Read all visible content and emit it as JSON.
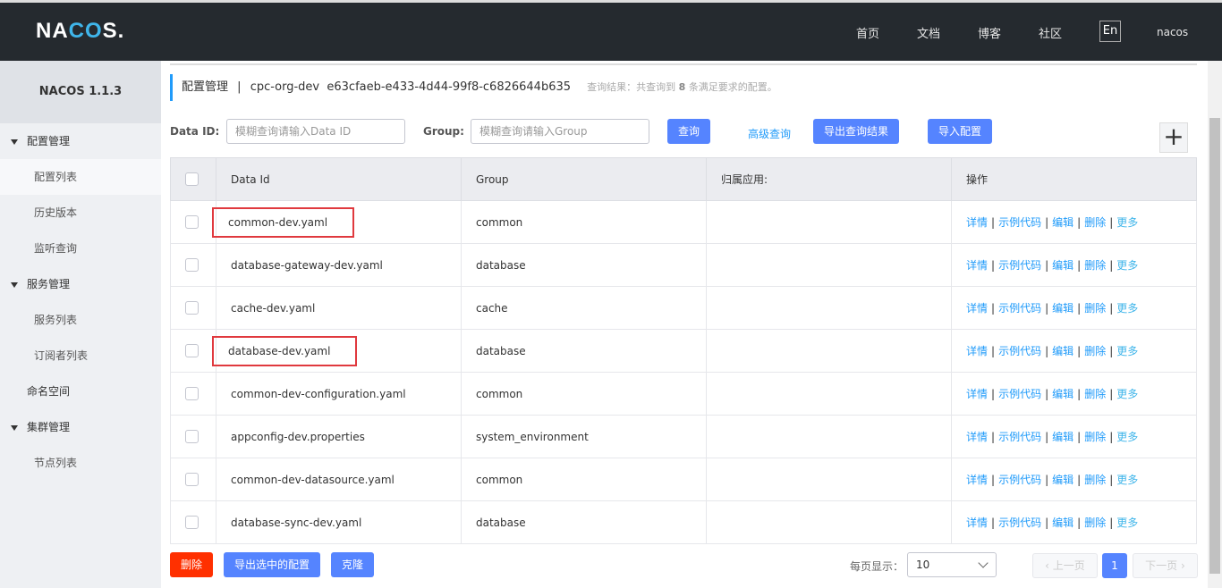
{
  "header": {
    "logo": "NACOS.",
    "logo_a": "NA",
    "logo_b": "CO",
    "logo_c": "S.",
    "nav": [
      "首页",
      "文档",
      "博客",
      "社区"
    ],
    "lang": "En",
    "user": "nacos"
  },
  "sidebar": {
    "title": "NACOS 1.1.3",
    "items": [
      {
        "label": "配置管理",
        "level": 1
      },
      {
        "label": "配置列表",
        "level": 2
      },
      {
        "label": "历史版本",
        "level": 2
      },
      {
        "label": "监听查询",
        "level": 2
      },
      {
        "label": "服务管理",
        "level": 1
      },
      {
        "label": "服务列表",
        "level": 2
      },
      {
        "label": "订阅者列表",
        "level": 2
      },
      {
        "label": "命名空间",
        "level": 0
      },
      {
        "label": "集群管理",
        "level": 1
      },
      {
        "label": "节点列表",
        "level": 2
      }
    ]
  },
  "page": {
    "title": "配置管理",
    "sep": "|",
    "namespace": "cpc-org-dev",
    "namespace_id": "e63cfaeb-e433-4d44-99f8-c6826644b635",
    "hint_pre": "查询结果：共查询到",
    "hint_count": "8",
    "hint_post": "条满足要求的配置。"
  },
  "filters": {
    "dataid_label": "Data ID:",
    "dataid_placeholder": "模糊查询请输入Data ID",
    "group_label": "Group:",
    "group_placeholder": "模糊查询请输入Group",
    "search": "查询",
    "advanced": "高级查询",
    "export_results": "导出查询结果",
    "import": "导入配置",
    "add": "+"
  },
  "table": {
    "headers": [
      "Data Id",
      "Group",
      "归属应用:",
      "操作"
    ],
    "rows": [
      {
        "data_id": "common-dev.yaml",
        "group": "common",
        "app": "",
        "highlighted": true
      },
      {
        "data_id": "database-gateway-dev.yaml",
        "group": "database",
        "app": ""
      },
      {
        "data_id": "cache-dev.yaml",
        "group": "cache",
        "app": ""
      },
      {
        "data_id": "database-dev.yaml",
        "group": "database",
        "app": "",
        "highlighted": true
      },
      {
        "data_id": "common-dev-configuration.yaml",
        "group": "common",
        "app": ""
      },
      {
        "data_id": "appconfig-dev.properties",
        "group": "system_environment",
        "app": ""
      },
      {
        "data_id": "common-dev-datasource.yaml",
        "group": "common",
        "app": ""
      },
      {
        "data_id": "database-sync-dev.yaml",
        "group": "database",
        "app": ""
      }
    ],
    "actions": [
      "详情",
      "示例代码",
      "编辑",
      "删除",
      "更多"
    ]
  },
  "footer": {
    "delete": "删除",
    "export_selected": "导出选中的配置",
    "clone": "克隆",
    "page_size_label": "每页显示：",
    "page_size": "10",
    "prev": "上一页",
    "current_page": "1",
    "next": "下一页"
  },
  "colors": {
    "header": "#252a2f",
    "primary": "#5584ff",
    "danger": "#ff3000",
    "link": "#209bfa"
  }
}
